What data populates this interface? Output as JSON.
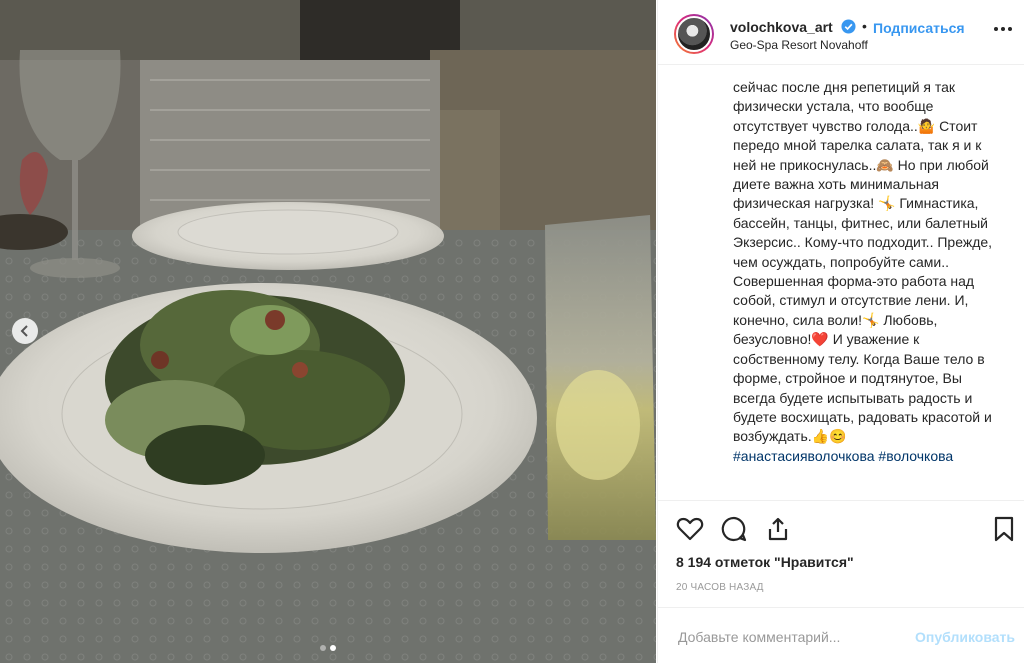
{
  "post": {
    "username": "volochkova_art",
    "verified_icon": "verified-badge-icon",
    "separator": "•",
    "follow_label": "Подписаться",
    "location": "Geo-Spa Resort Novahoff",
    "caption_text": "сейчас после дня репетиций я так физически устала, что вообще отсутствует чувство голода..🤷 Стоит передо мной тарелка салата, так я и к ней не прикоснулась..🙈 Но при любой диете важна хоть минимальная физическая нагрузка! 🤸 Гимнастика, бассейн, танцы, фитнес, или балетный Экзерсис.. Кому-что подходит.. Прежде, чем осуждать, попробуйте сами.. Совершенная форма-это работа над собой, стимул и отсутствие лени. И, конечно, сила воли!🤸 Любовь, безусловно!❤️ И уважение к собственному телу. Когда Ваше тело в форме, стройное и подтянутое, Вы всегда будете испытывать радость и будете восхищать, радовать красотой и возбуждать.👍😊",
    "hashtags": "#анастасияволочкова #волочкова",
    "likes": "8 194 отметок \"Нравится\"",
    "time_ago": "20 ЧАСОВ НАЗАД",
    "comment_placeholder": "Добавьте комментарий...",
    "publish_label": "Опубликовать"
  },
  "carousel": {
    "total": 2,
    "active": 2
  },
  "colors": {
    "accent": "#3897f0",
    "publish_disabled": "#b2dffc",
    "hashtag": "#003569",
    "heart": "#d7262e"
  }
}
